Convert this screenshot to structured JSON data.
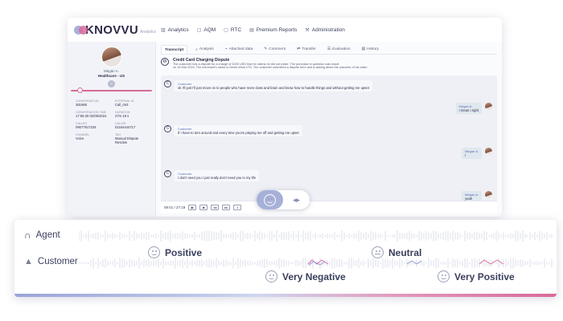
{
  "app": {
    "logo_text": "KNOVVU",
    "logo_sub": "Analytics",
    "nav": [
      {
        "icon": "bar-chart-icon",
        "label": "Analytics"
      },
      {
        "icon": "square-icon",
        "label": "AQM"
      },
      {
        "icon": "square-icon",
        "label": "RTC"
      },
      {
        "icon": "file-icon",
        "label": "Premium Reports"
      },
      {
        "icon": "wrench-icon",
        "label": "Administration"
      }
    ]
  },
  "profile": {
    "name": "Megan A.",
    "team": "Healthcare - US",
    "fields": [
      {
        "label": "Conversation",
        "value": "381965"
      },
      {
        "label": "External ID",
        "value": "Call_044"
      },
      {
        "label": "Conversation time",
        "value": "17:55:30 02/05/2024"
      },
      {
        "label": "Duration",
        "value": "27m 19 s"
      },
      {
        "label": "Caller",
        "value": "09077817234"
      },
      {
        "label": "Callee",
        "value": "01164444717"
      },
      {
        "label": "Channel",
        "value": "Voice"
      },
      {
        "label": "Tag",
        "value": "Manual Dispute Resolve"
      }
    ]
  },
  "tabs": [
    {
      "label": "Transcript",
      "active": true
    },
    {
      "label": "Analysis"
    },
    {
      "label": "Attached data"
    },
    {
      "label": "Comment"
    },
    {
      "label": "Transfer"
    },
    {
      "label": "Evaluation"
    },
    {
      "label": "History"
    }
  ],
  "summary": {
    "title": "Credit Card Charging Dispute",
    "text_1": "The customer has a dispute for a charge of 1000 USD that he claims he did not make. The purchase in question was made",
    "text_2": "on 16 Mar 2024. The merchant's name is Derek West LTD. The customer submitted a dispute form and is asking about the outcome of his claim."
  },
  "messages": [
    {
      "role": "customer",
      "sender": "Customer",
      "text": "ok I'll just I'll just move on to people who have more class and brain and know how to handle things and without getting me upset"
    },
    {
      "role": "agent",
      "sender": "Megan A.",
      "text": "I mean I right"
    },
    {
      "role": "customer",
      "sender": "Customer",
      "text": "If I have to turn around and every time you're playing me off and getting me upset"
    },
    {
      "role": "agent",
      "sender": "Megan A.",
      "text": "I"
    },
    {
      "role": "customer",
      "sender": "Customer",
      "text": "I don't need you I just really don't need you in my life"
    },
    {
      "role": "agent",
      "sender": "Megan A.",
      "text": "yeah"
    }
  ],
  "player": {
    "time": "09:01 / 27:19"
  },
  "timeline": {
    "agent_label": "Agent",
    "customer_label": "Customer",
    "sentiments": [
      "Positive",
      "Neutral",
      "Very Negative",
      "Very Positive"
    ]
  },
  "colors": {
    "accent_pink": "#d86a9a",
    "accent_blue": "#a7b0d8",
    "text_dark": "#2d2a4a"
  }
}
